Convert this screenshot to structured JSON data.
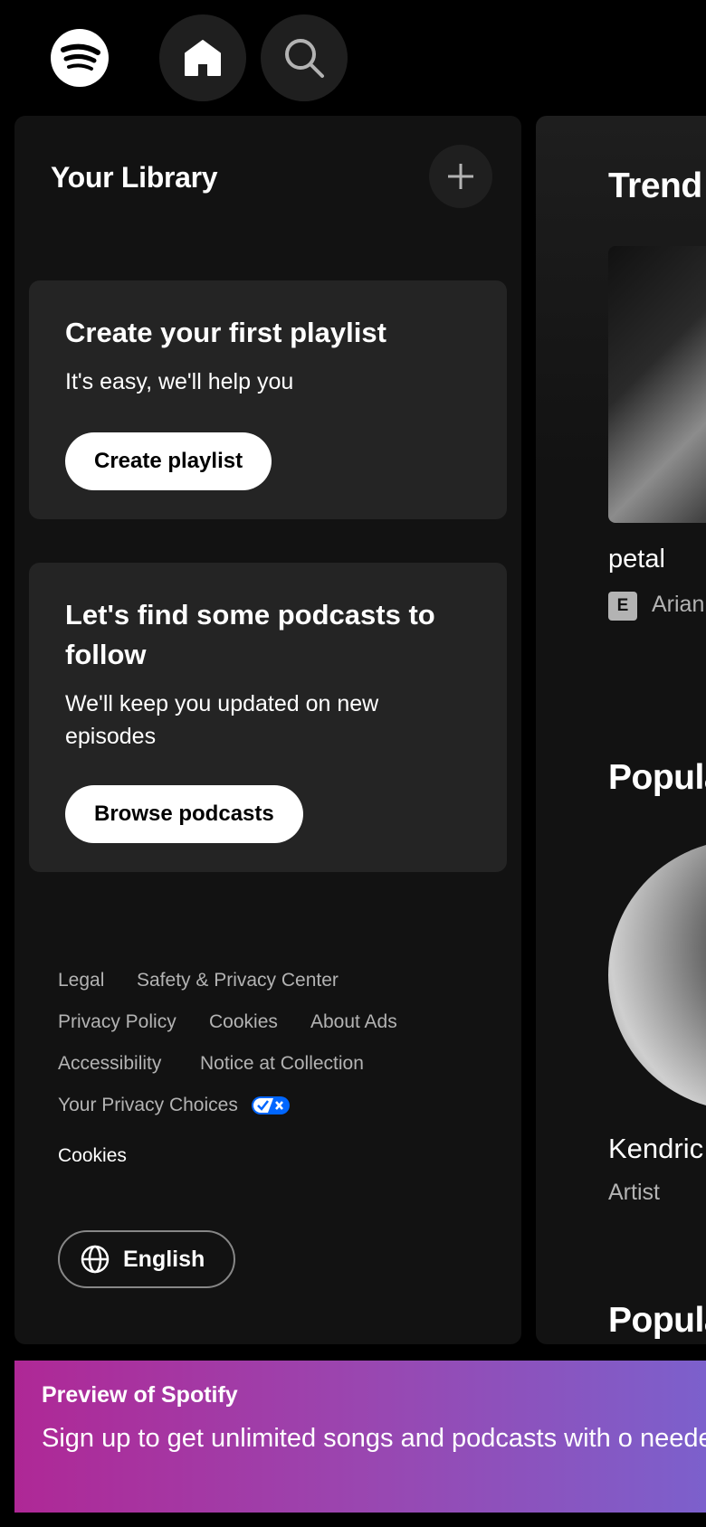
{
  "colors": {
    "background": "#000000",
    "panel": "#121212",
    "card": "#242424",
    "text_primary": "#ffffff",
    "text_secondary": "#b3b3b3",
    "banner_start": "#af2896",
    "banner_end": "#7c60cc"
  },
  "header": {
    "logo_icon": "spotify-logo-icon",
    "home_icon": "home-icon",
    "search_icon": "search-icon"
  },
  "library": {
    "title": "Your Library",
    "add_icon": "plus-icon",
    "playlist_card": {
      "title": "Create your first playlist",
      "subtitle": "It's easy, we'll help you",
      "button_label": "Create playlist"
    },
    "podcast_card": {
      "title": "Let's find some podcasts to follow",
      "subtitle": "We'll keep you updated on new episodes",
      "button_label": "Browse podcasts"
    },
    "footer_links": [
      "Legal",
      "Safety & Privacy Center",
      "Privacy Policy",
      "Cookies",
      "About Ads",
      "Accessibility",
      "Notice at Collection",
      "Your Privacy Choices"
    ],
    "cookies_link": "Cookies",
    "language_button": "English"
  },
  "main": {
    "section_1_title": "Trend",
    "song_title": "petal",
    "explicit_badge": "E",
    "song_artist": "Arian",
    "section_2_title": "Popula",
    "artist_name": "Kendric",
    "artist_type": "Artist",
    "section_3_title": "Popula"
  },
  "banner": {
    "title": "Preview of Spotify",
    "text": "Sign up to get unlimited songs and podcasts with o needed."
  }
}
